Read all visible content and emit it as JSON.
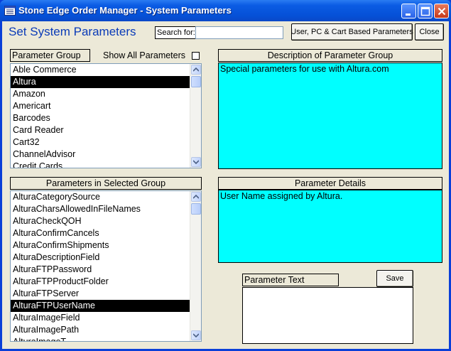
{
  "window": {
    "title": "Stone Edge Order Manager - System Parameters"
  },
  "header": {
    "heading": "Set System Parameters",
    "search_label": "Search for:",
    "search_value": "",
    "user_pc_cart_button": "User, PC & Cart Based Parameters",
    "close_button": "Close"
  },
  "parameter_group": {
    "label": "Parameter Group",
    "show_all_label": "Show All Parameters",
    "show_all_checked": false,
    "items": [
      "Able Commerce",
      "Altura",
      "Amazon",
      "Americart",
      "Barcodes",
      "Card Reader",
      "Cart32",
      "ChannelAdvisor",
      "Credit Cards"
    ],
    "selected": "Altura"
  },
  "group_description": {
    "label": "Description of Parameter Group",
    "text": "Special parameters for use with Altura.com"
  },
  "selected_group_params": {
    "label": "Parameters in Selected Group",
    "items": [
      "AlturaCategorySource",
      "AlturaCharsAllowedInFileNames",
      "AlturaCheckQOH",
      "AlturaConfirmCancels",
      "AlturaConfirmShipments",
      "AlturaDescriptionField",
      "AlturaFTPPassword",
      "AlturaFTPProductFolder",
      "AlturaFTPServer",
      "AlturaFTPUserName",
      "AlturaImageField",
      "AlturaImagePath",
      "AlturaImageT"
    ],
    "selected": "AlturaFTPUserName"
  },
  "parameter_details": {
    "label": "Parameter Details",
    "text": "User Name assigned by Altura."
  },
  "parameter_text": {
    "label": "Parameter Text",
    "value": "",
    "save_button": "Save"
  },
  "icons": {
    "app": "application-menu-icon",
    "minimize": "minimize-icon",
    "maximize": "maximize-icon",
    "close": "close-icon"
  },
  "colors": {
    "heading": "#0a3bb8",
    "description_background": "#00ffff",
    "selection": "#000000",
    "titlebar": "#0550d6"
  }
}
